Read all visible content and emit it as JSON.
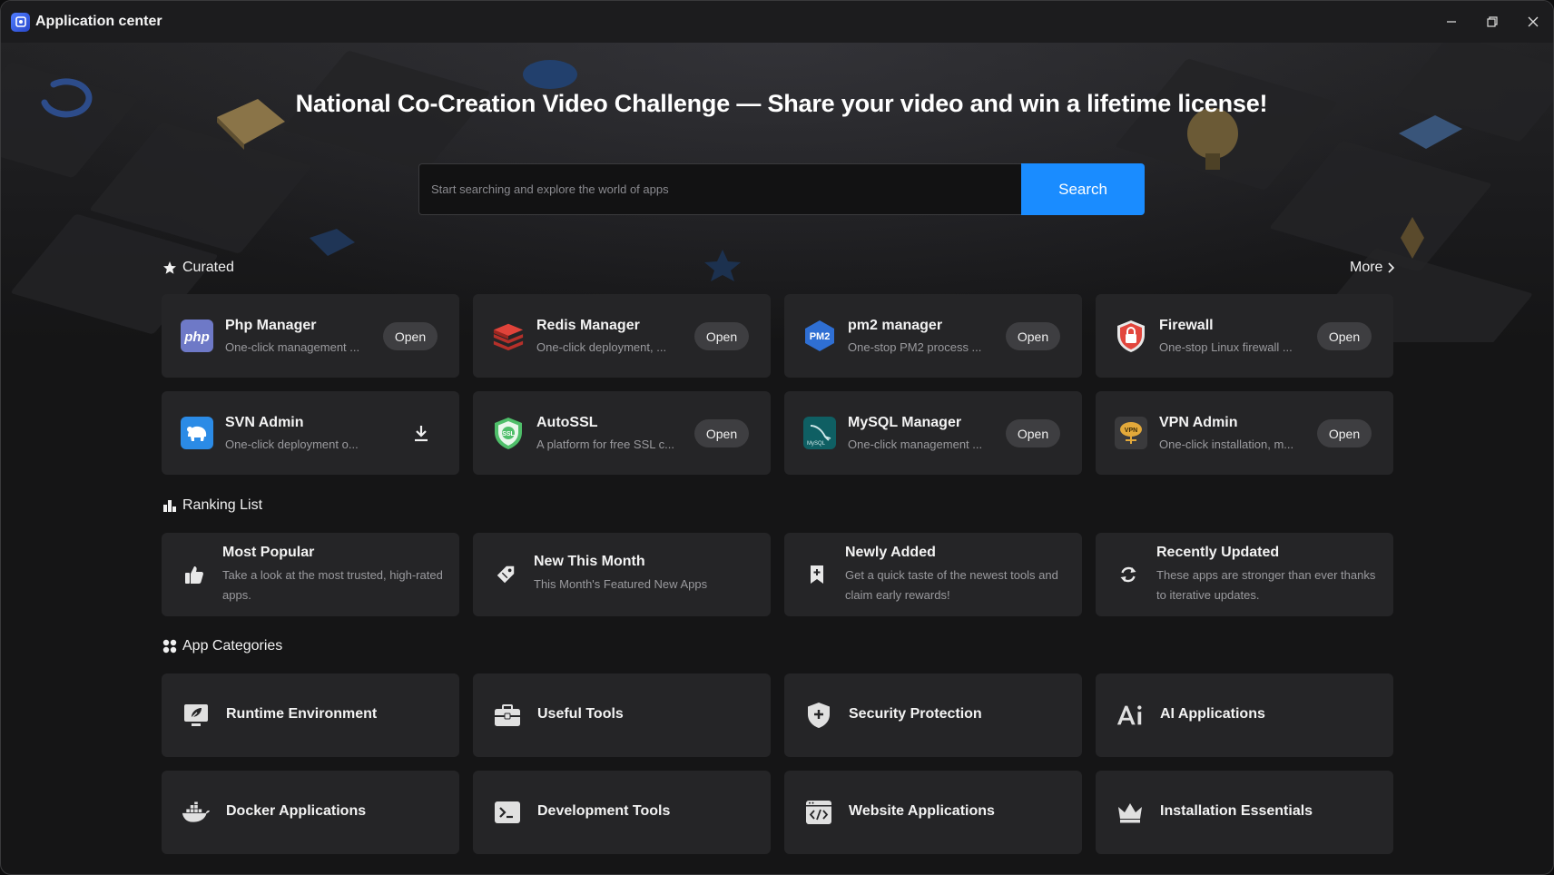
{
  "window": {
    "title": "Application center"
  },
  "hero": {
    "headline": "National Co-Creation Video Challenge — Share your video and win a lifetime license!",
    "search_placeholder": "Start searching and explore the world of apps",
    "search_button": "Search"
  },
  "curated": {
    "title": "Curated",
    "more_label": "More",
    "apps": [
      {
        "name": "Php Manager",
        "desc": "One-click management ...",
        "action": "Open",
        "icon": "php-icon"
      },
      {
        "name": "Redis Manager",
        "desc": "One-click deployment, ...",
        "action": "Open",
        "icon": "redis-icon"
      },
      {
        "name": "pm2 manager",
        "desc": "One-stop PM2 process ...",
        "action": "Open",
        "icon": "pm2-icon"
      },
      {
        "name": "Firewall",
        "desc": "One-stop Linux firewall ...",
        "action": "Open",
        "icon": "firewall-icon"
      },
      {
        "name": "SVN Admin",
        "desc": "One-click deployment o...",
        "action": "download",
        "icon": "svn-icon"
      },
      {
        "name": "AutoSSL",
        "desc": "A platform for free SSL c...",
        "action": "Open",
        "icon": "ssl-icon"
      },
      {
        "name": "MySQL Manager",
        "desc": "One-click management ...",
        "action": "Open",
        "icon": "mysql-icon"
      },
      {
        "name": "VPN Admin",
        "desc": "One-click installation, m...",
        "action": "Open",
        "icon": "vpn-icon"
      }
    ]
  },
  "ranking": {
    "title": "Ranking List",
    "items": [
      {
        "title": "Most Popular",
        "desc": "Take a look at the most trusted, high-rated apps.",
        "icon": "thumbs-up-icon"
      },
      {
        "title": "New This Month",
        "desc": "This Month's Featured New Apps",
        "icon": "tag-icon"
      },
      {
        "title": "Newly Added",
        "desc": "Get a quick taste of the newest tools and claim early rewards!",
        "icon": "bookmark-plus-icon"
      },
      {
        "title": "Recently Updated",
        "desc": "These apps are stronger than ever thanks to iterative updates.",
        "icon": "refresh-icon"
      }
    ]
  },
  "categories": {
    "title": "App Categories",
    "items": [
      {
        "label": "Runtime Environment",
        "icon": "runtime-icon"
      },
      {
        "label": "Useful Tools",
        "icon": "toolbox-icon"
      },
      {
        "label": "Security Protection",
        "icon": "shield-plus-icon"
      },
      {
        "label": "AI Applications",
        "icon": "ai-icon"
      },
      {
        "label": "Docker Applications",
        "icon": "docker-icon"
      },
      {
        "label": "Development Tools",
        "icon": "terminal-icon"
      },
      {
        "label": "Website Applications",
        "icon": "code-window-icon"
      },
      {
        "label": "Installation Essentials",
        "icon": "crown-icon"
      }
    ]
  },
  "colors": {
    "accent": "#1a8cff",
    "card": "#252527",
    "background": "#151516"
  }
}
